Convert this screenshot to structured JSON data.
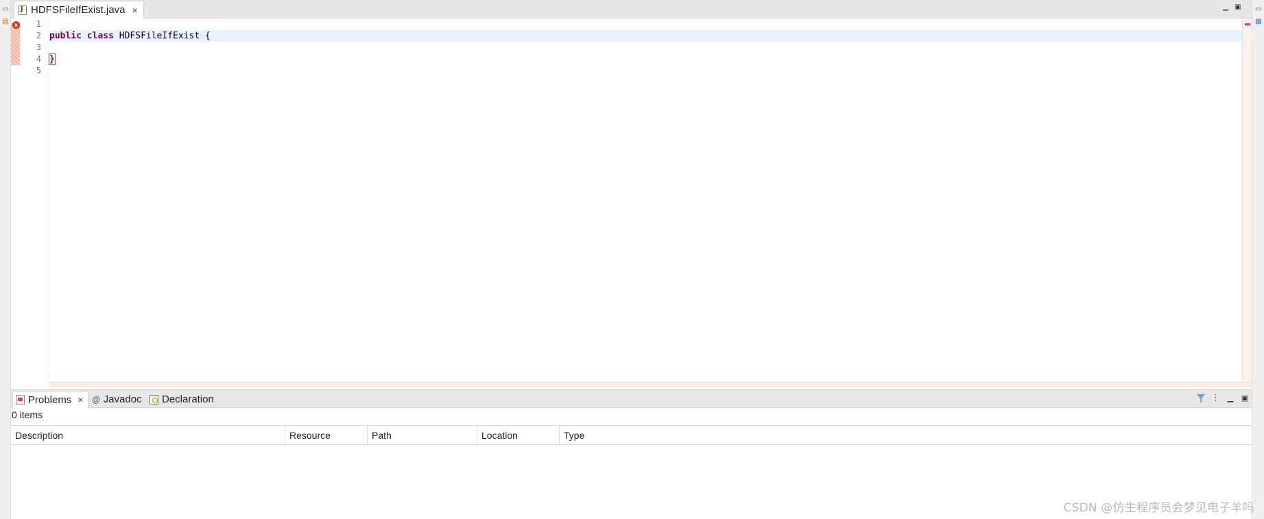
{
  "editor": {
    "tab": {
      "title": "HDFSFileIfExist.java",
      "icon": "java-file-icon",
      "close": "×"
    },
    "line_numbers": [
      "1",
      "2",
      "3",
      "4",
      "5"
    ],
    "code": {
      "line2": {
        "kw1": "public",
        "kw2": "class",
        "name": " HDFSFileIfExist {"
      },
      "line4": {
        "brace": "}"
      }
    },
    "error_marker": "x",
    "colors": {
      "keyword": "#7f0055",
      "current_line": "#e8f2fe",
      "error": "#d8331f"
    }
  },
  "problems_view": {
    "tabs": [
      {
        "label": "Problems",
        "icon": "problems-icon",
        "close": "×"
      },
      {
        "label": "Javadoc",
        "icon": "at-icon",
        "glyph": "@"
      },
      {
        "label": "Declaration",
        "icon": "declaration-icon"
      }
    ],
    "item_count": "0 items",
    "columns": [
      "Description",
      "Resource",
      "Path",
      "Location",
      "Type"
    ],
    "rows": []
  },
  "watermark": "CSDN @仿生程序员会梦见电子羊吗"
}
